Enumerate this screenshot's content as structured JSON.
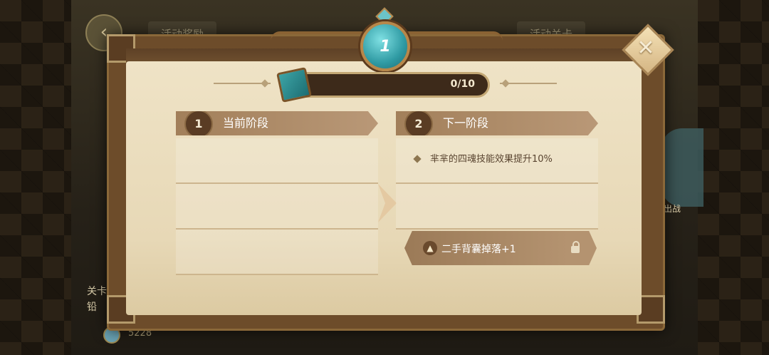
{
  "background": {
    "tab_left": "活动奖励",
    "tab_right": "活动关卡",
    "side_button": "出战",
    "left_labels": [
      "关卡",
      "铅"
    ],
    "coin_count": "5228"
  },
  "dialog": {
    "level": "1",
    "progress": {
      "text": "0/10",
      "current": 0,
      "max": 10
    },
    "current_stage": {
      "number": "1",
      "title": "当前阶段"
    },
    "next_stage": {
      "number": "2",
      "title": "下一阶段",
      "effect": "芈芈的四魂技能效果提升10%",
      "drop": "二手背囊掉落+1"
    }
  },
  "colors": {
    "parchment": "#efe3c6",
    "header": "#a27f5a",
    "medal": "#2f9aa3"
  },
  "icons": [
    "back-arrow-icon",
    "close-icon",
    "book-icon",
    "lock-icon",
    "flame-icon",
    "next-arrow-icon"
  ]
}
